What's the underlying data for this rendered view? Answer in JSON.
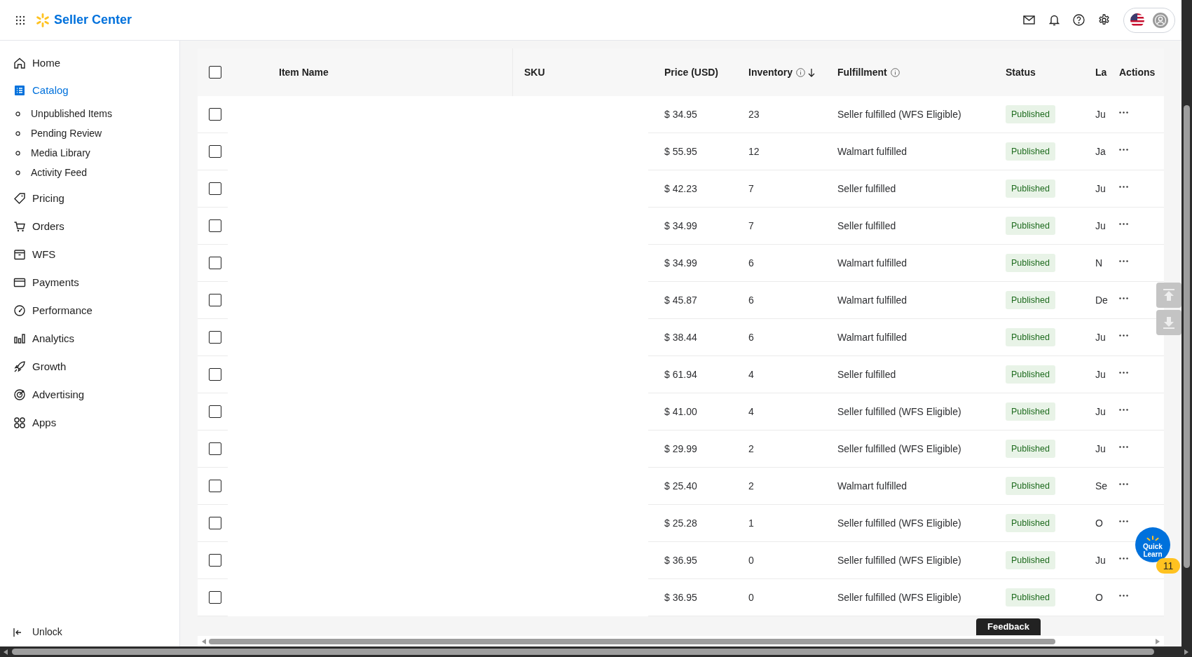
{
  "header": {
    "app_name": "Seller Center"
  },
  "sidebar": {
    "items": [
      {
        "label": "Home",
        "selected": false
      },
      {
        "label": "Catalog",
        "selected": true,
        "children": [
          {
            "label": "Unpublished Items",
            "selected": false
          },
          {
            "label": "Pending Review",
            "selected": false
          },
          {
            "label": "Media Library",
            "selected": false
          },
          {
            "label": "Activity Feed",
            "selected": false
          }
        ]
      },
      {
        "label": "Pricing",
        "selected": false
      },
      {
        "label": "Orders",
        "selected": false
      },
      {
        "label": "WFS",
        "selected": false
      },
      {
        "label": "Payments",
        "selected": false
      },
      {
        "label": "Performance",
        "selected": false
      },
      {
        "label": "Analytics",
        "selected": false
      },
      {
        "label": "Growth",
        "selected": false
      },
      {
        "label": "Advertising",
        "selected": false
      },
      {
        "label": "Apps",
        "selected": false
      }
    ],
    "footer": "Unlock"
  },
  "table": {
    "select_all_checked": false,
    "columns": [
      {
        "label": "Item Name",
        "info": false,
        "sorted": false
      },
      {
        "label": "SKU",
        "info": false,
        "sorted": false
      },
      {
        "label": "Price (USD)",
        "info": false,
        "sorted": false
      },
      {
        "label": "Inventory",
        "info": true,
        "sorted": true
      },
      {
        "label": "Fulfillment",
        "info": true,
        "sorted": false
      },
      {
        "label": "Status",
        "info": false,
        "sorted": false
      },
      {
        "label": "La",
        "info": false,
        "sorted": false
      },
      {
        "label": "Actions",
        "info": false,
        "sorted": false
      }
    ],
    "rows": [
      {
        "checked": false,
        "price": "$ 34.95",
        "inventory": "23",
        "fulfillment": "Seller fulfilled (WFS Eligible)",
        "status": "Published",
        "last": "Ju"
      },
      {
        "checked": false,
        "price": "$ 55.95",
        "inventory": "12",
        "fulfillment": "Walmart fulfilled",
        "status": "Published",
        "last": "Ja"
      },
      {
        "checked": false,
        "price": "$ 42.23",
        "inventory": "7",
        "fulfillment": "Seller fulfilled",
        "status": "Published",
        "last": "Ju"
      },
      {
        "checked": false,
        "price": "$ 34.99",
        "inventory": "7",
        "fulfillment": "Seller fulfilled",
        "status": "Published",
        "last": "Ju"
      },
      {
        "checked": false,
        "price": "$ 34.99",
        "inventory": "6",
        "fulfillment": "Walmart fulfilled",
        "status": "Published",
        "last": "N"
      },
      {
        "checked": false,
        "price": "$ 45.87",
        "inventory": "6",
        "fulfillment": "Walmart fulfilled",
        "status": "Published",
        "last": "De"
      },
      {
        "checked": false,
        "price": "$ 38.44",
        "inventory": "6",
        "fulfillment": "Walmart fulfilled",
        "status": "Published",
        "last": "Ju"
      },
      {
        "checked": false,
        "price": "$ 61.94",
        "inventory": "4",
        "fulfillment": "Seller fulfilled",
        "status": "Published",
        "last": "Ju"
      },
      {
        "checked": false,
        "price": "$ 41.00",
        "inventory": "4",
        "fulfillment": "Seller fulfilled (WFS Eligible)",
        "status": "Published",
        "last": "Ju"
      },
      {
        "checked": false,
        "price": "$ 29.99",
        "inventory": "2",
        "fulfillment": "Seller fulfilled (WFS Eligible)",
        "status": "Published",
        "last": "Ju"
      },
      {
        "checked": false,
        "price": "$ 25.40",
        "inventory": "2",
        "fulfillment": "Walmart fulfilled",
        "status": "Published",
        "last": "Se"
      },
      {
        "checked": false,
        "price": "$ 25.28",
        "inventory": "1",
        "fulfillment": "Seller fulfilled (WFS Eligible)",
        "status": "Published",
        "last": "O"
      },
      {
        "checked": false,
        "price": "$ 36.95",
        "inventory": "0",
        "fulfillment": "Seller fulfilled (WFS Eligible)",
        "status": "Published",
        "last": "Ju"
      },
      {
        "checked": false,
        "price": "$ 36.95",
        "inventory": "0",
        "fulfillment": "Seller fulfilled (WFS Eligible)",
        "status": "Published",
        "last": "O"
      }
    ]
  },
  "feedback_button": "Feedback",
  "quick_learn": {
    "label": "Quick Learn",
    "count": "11"
  }
}
